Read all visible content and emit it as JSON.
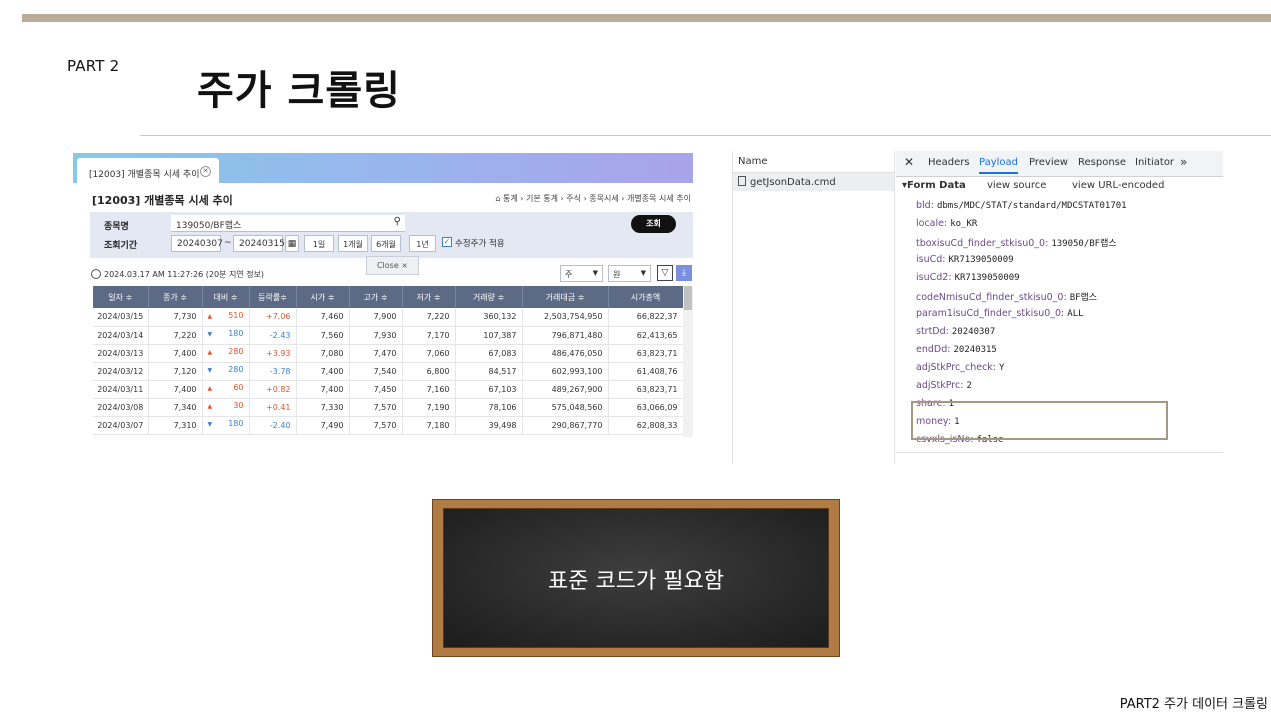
{
  "slide": {
    "part_label": "PART 2",
    "title": "주가 크롤링",
    "footer": "PART2 주가 데이터 크롤링",
    "board_text": "표준 코드가 필요함"
  },
  "krx": {
    "tab_label": "[12003] 개별종목 시세 추이",
    "heading": "[12003] 개별종목 시세 추이",
    "breadcrumb": "⌂ 통계 › 기본 통계 › 주식 › 종목시세 › 개별종목 시세 추이",
    "form": {
      "stock_label": "종목명",
      "stock_value": "139050/BF랩스",
      "period_label": "조회기간",
      "start_date": "20240307",
      "end_date": "20240315",
      "tilde": "~",
      "period_buttons": [
        "1일",
        "1개월",
        "6개월",
        "1년"
      ],
      "adj_label": "수정주가 적용",
      "search_label": "조회",
      "close_label": "Close ×"
    },
    "timestamp": "2024.03.17 AM 11:27:26 (20분 지연 정보)",
    "unit_select": "주",
    "currency_select": "원",
    "columns": [
      "일자 ≑",
      "종가 ≑",
      "대비 ≑",
      "등락률≑",
      "시가 ≑",
      "고가 ≑",
      "저가 ≑",
      "거래량 ≑",
      "거래대금 ≑",
      "시가총액"
    ],
    "rows": [
      {
        "date": "2024/03/15",
        "close": "7,730",
        "dir": "▲",
        "diff": "510",
        "rate": "+7.06",
        "open": "7,460",
        "high": "7,900",
        "low": "7,220",
        "vol": "360,132",
        "amount": "2,503,754,950",
        "cap": "66,822,37"
      },
      {
        "date": "2024/03/14",
        "close": "7,220",
        "dir": "▼",
        "diff": "180",
        "rate": "-2.43",
        "open": "7,560",
        "high": "7,930",
        "low": "7,170",
        "vol": "107,387",
        "amount": "796,871,480",
        "cap": "62,413,65"
      },
      {
        "date": "2024/03/13",
        "close": "7,400",
        "dir": "▲",
        "diff": "280",
        "rate": "+3.93",
        "open": "7,080",
        "high": "7,470",
        "low": "7,060",
        "vol": "67,083",
        "amount": "486,476,050",
        "cap": "63,823,71"
      },
      {
        "date": "2024/03/12",
        "close": "7,120",
        "dir": "▼",
        "diff": "280",
        "rate": "-3.78",
        "open": "7,400",
        "high": "7,540",
        "low": "6,800",
        "vol": "84,517",
        "amount": "602,993,100",
        "cap": "61,408,76"
      },
      {
        "date": "2024/03/11",
        "close": "7,400",
        "dir": "▲",
        "diff": "60",
        "rate": "+0.82",
        "open": "7,400",
        "high": "7,450",
        "low": "7,160",
        "vol": "67,103",
        "amount": "489,267,900",
        "cap": "63,823,71"
      },
      {
        "date": "2024/03/08",
        "close": "7,340",
        "dir": "▲",
        "diff": "30",
        "rate": "+0.41",
        "open": "7,330",
        "high": "7,570",
        "low": "7,190",
        "vol": "78,106",
        "amount": "575,048,560",
        "cap": "63,066,09"
      },
      {
        "date": "2024/03/07",
        "close": "7,310",
        "dir": "▼",
        "diff": "180",
        "rate": "-2.40",
        "open": "7,490",
        "high": "7,570",
        "low": "7,180",
        "vol": "39,498",
        "amount": "290,867,770",
        "cap": "62,808,33"
      }
    ],
    "colors": {
      "up": "#e8542d",
      "down": "#3b7fd6",
      "header": "#5d6a85"
    }
  },
  "devtools": {
    "name_header": "Name",
    "file": "getJsonData.cmd",
    "tabs": [
      "Headers",
      "Payload",
      "Preview",
      "Response",
      "Initiator"
    ],
    "active_tab": "Payload",
    "form_data_label": "▾Form Data",
    "view_source": "view source",
    "view_url_encoded": "view URL-encoded",
    "fields": [
      {
        "key": "bld:",
        "value": "dbms/MDC/STAT/standard/MDCSTAT01701"
      },
      {
        "key": "locale:",
        "value": "ko_KR"
      },
      {
        "key": "tboxisuCd_finder_stkisu0_0:",
        "value": "139050/BF랩스"
      },
      {
        "key": "isuCd:",
        "value": "KR7139050009"
      },
      {
        "key": "isuCd2:",
        "value": "KR7139050009"
      },
      {
        "key": "codeNmisuCd_finder_stkisu0_0:",
        "value": "BF랩스"
      },
      {
        "key": "param1isuCd_finder_stkisu0_0:",
        "value": "ALL"
      },
      {
        "key": "strtDd:",
        "value": "20240307"
      },
      {
        "key": "endDd:",
        "value": "20240315"
      },
      {
        "key": "adjStkPrc_check:",
        "value": "Y"
      },
      {
        "key": "adjStkPrc:",
        "value": "2"
      },
      {
        "key": "share:",
        "value": "1"
      },
      {
        "key": "money:",
        "value": "1"
      },
      {
        "key": "csvxls_isNo:",
        "value": "false"
      }
    ]
  }
}
